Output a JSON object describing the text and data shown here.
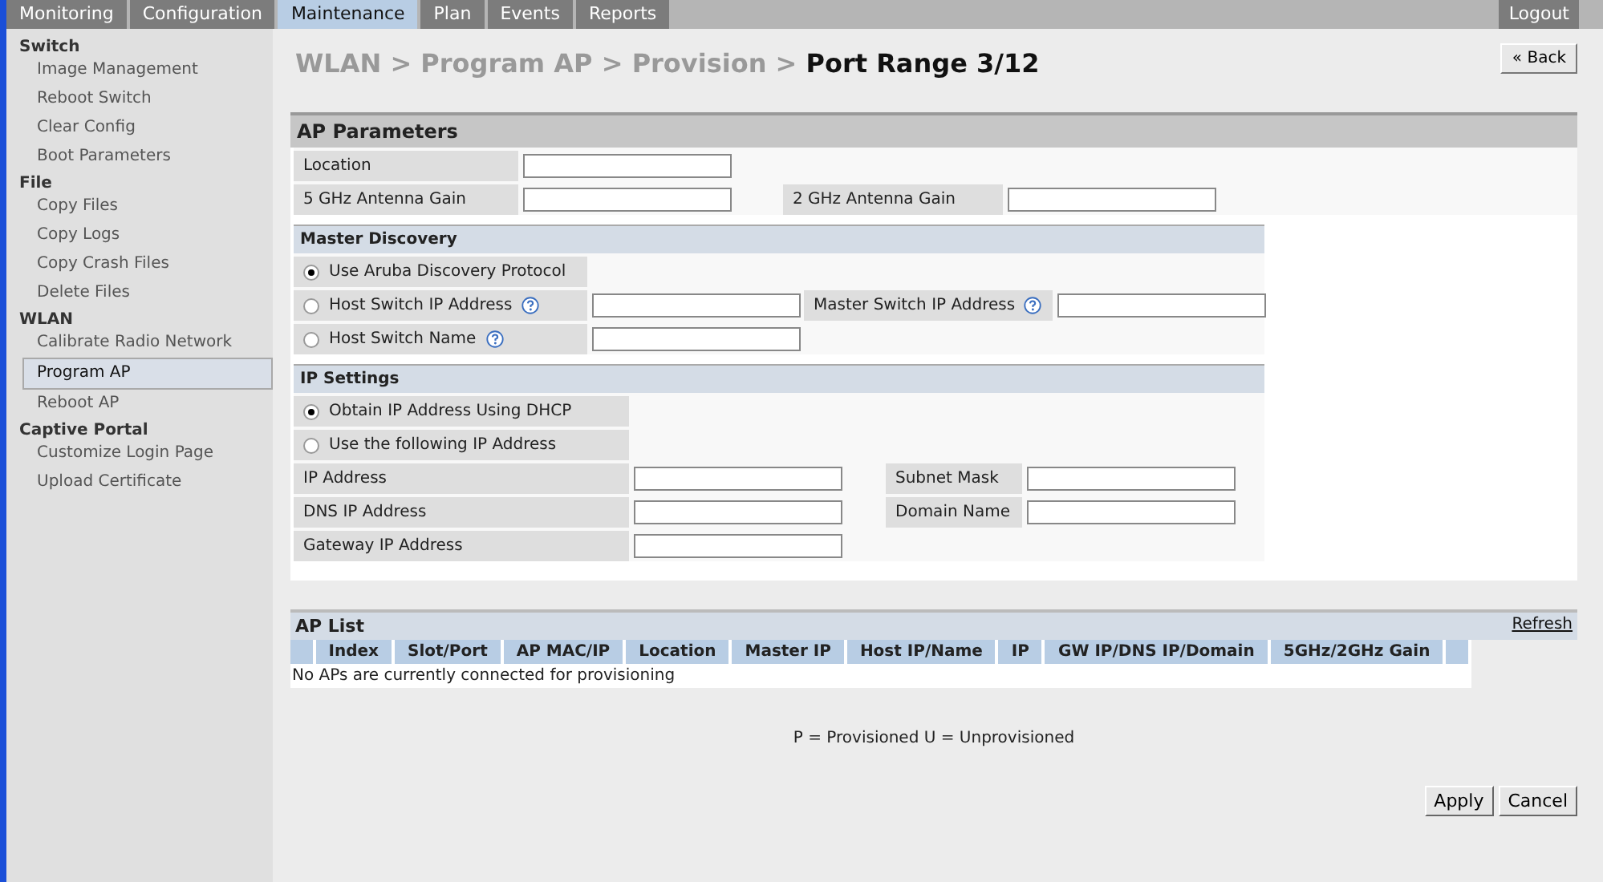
{
  "nav": {
    "tabs": [
      {
        "label": "Monitoring",
        "selected": false
      },
      {
        "label": "Configuration",
        "selected": false
      },
      {
        "label": "Maintenance",
        "selected": true
      },
      {
        "label": "Plan",
        "selected": false
      },
      {
        "label": "Events",
        "selected": false
      },
      {
        "label": "Reports",
        "selected": false
      }
    ],
    "logout": "Logout"
  },
  "sidebar": {
    "groups": [
      {
        "title": "Switch",
        "items": [
          {
            "label": "Image Management",
            "selected": false
          },
          {
            "label": "Reboot Switch",
            "selected": false
          },
          {
            "label": "Clear Config",
            "selected": false
          },
          {
            "label": "Boot Parameters",
            "selected": false
          }
        ]
      },
      {
        "title": "File",
        "items": [
          {
            "label": "Copy Files",
            "selected": false
          },
          {
            "label": "Copy Logs",
            "selected": false
          },
          {
            "label": "Copy Crash Files",
            "selected": false
          },
          {
            "label": "Delete Files",
            "selected": false
          }
        ]
      },
      {
        "title": "WLAN",
        "items": [
          {
            "label": "Calibrate Radio Network",
            "selected": false
          },
          {
            "label": "Program AP",
            "selected": true
          },
          {
            "label": "Reboot AP",
            "selected": false
          }
        ]
      },
      {
        "title": "Captive Portal",
        "items": [
          {
            "label": "Customize Login Page",
            "selected": false
          },
          {
            "label": "Upload Certificate",
            "selected": false
          }
        ]
      }
    ]
  },
  "breadcrumb": "WLAN > Program AP > Provision > **Port Range 3/12**",
  "back_button": "« Back",
  "panel": {
    "title": "AP Parameters",
    "sections": [
      {
        "kind": "params",
        "rows": [
          [
            {
              "kind": "label",
              "label": "Location",
              "help": false
            },
            {
              "kind": "field"
            }
          ],
          [
            {
              "kind": "label",
              "label": "5 GHz Antenna Gain",
              "help": false
            },
            {
              "kind": "field"
            },
            {
              "kind": "label",
              "label": "2 GHz Antenna Gain",
              "help": false
            },
            {
              "kind": "field"
            }
          ]
        ]
      },
      {
        "kind": "discovery",
        "title": "Master Discovery",
        "rows": [
          [
            {
              "kind": "radio",
              "label": "Use Aruba Discovery Protocol",
              "selected": true,
              "help": false
            }
          ],
          [
            {
              "kind": "radio",
              "label": "Host Switch IP Address",
              "selected": false,
              "help": true
            },
            {
              "kind": "field"
            },
            {
              "kind": "label",
              "label": "Master Switch IP Address",
              "help": true
            },
            {
              "kind": "field"
            }
          ],
          [
            {
              "kind": "radio",
              "label": "Host Switch Name",
              "selected": false,
              "help": true
            },
            {
              "kind": "field"
            }
          ]
        ]
      },
      {
        "kind": "ip",
        "title": "IP Settings",
        "rows": [
          [
            {
              "kind": "radio",
              "label": "Obtain IP Address Using DHCP",
              "selected": true,
              "help": false
            }
          ],
          [
            {
              "kind": "radio",
              "label": "Use the following IP Address",
              "selected": false,
              "help": false
            }
          ],
          [
            {
              "kind": "label",
              "label": "IP Address",
              "help": false
            },
            {
              "kind": "field"
            },
            {
              "kind": "label",
              "label": "Subnet Mask",
              "help": false
            },
            {
              "kind": "field"
            }
          ],
          [
            {
              "kind": "label",
              "label": "DNS IP Address",
              "help": false
            },
            {
              "kind": "field"
            },
            {
              "kind": "label",
              "label": "Domain Name",
              "help": false
            },
            {
              "kind": "field"
            }
          ],
          [
            {
              "kind": "label",
              "label": "Gateway IP Address",
              "help": false
            },
            {
              "kind": "field"
            }
          ]
        ]
      }
    ]
  },
  "ap_list": {
    "title": "AP List",
    "refresh": "Refresh",
    "columns": [
      "Index",
      "Slot/Port",
      "AP MAC/IP",
      "Location",
      "Master IP",
      "Host IP/Name",
      "IP",
      "GW IP/DNS IP/Domain",
      "5GHz/2GHz Gain"
    ],
    "empty_message": "No APs are currently connected for provisioning"
  },
  "legend": "P = Provisioned U = Unprovisioned",
  "buttons": [
    "Apply",
    "Cancel"
  ]
}
